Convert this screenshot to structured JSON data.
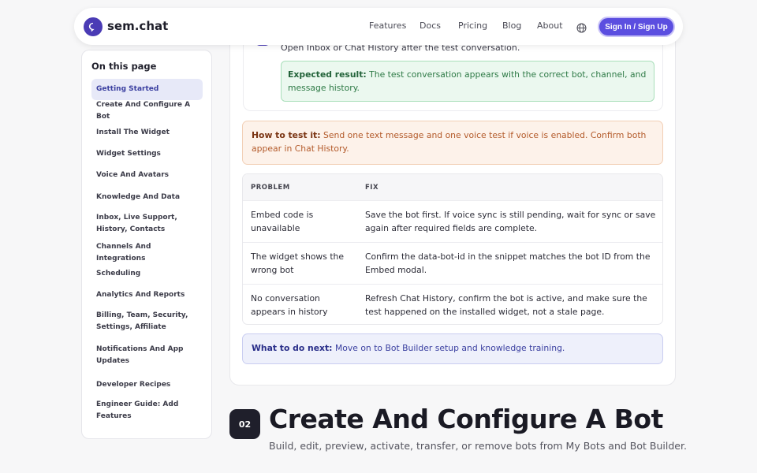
{
  "header": {
    "brand": "sem.chat",
    "nav": [
      "Features",
      "Docs",
      "Pricing",
      "Blog",
      "About"
    ],
    "signin_label": "Sign In / Sign Up"
  },
  "sidebar": {
    "title": "On this page",
    "items": [
      {
        "label": "Getting Started"
      },
      {
        "label": "Create And Configure A Bot"
      },
      {
        "label": "Install The Widget"
      },
      {
        "label": "Widget Settings"
      },
      {
        "label": "Voice And Avatars"
      },
      {
        "label": "Knowledge And Data"
      },
      {
        "label": "Inbox, Live Support, History, Contacts"
      },
      {
        "label": "Channels And Integrations"
      },
      {
        "label": "Scheduling"
      },
      {
        "label": "Analytics And Reports"
      },
      {
        "label": "Billing, Team, Security, Settings, Affiliate"
      },
      {
        "label": "Notifications And App Updates"
      },
      {
        "label": "Developer Recipes"
      },
      {
        "label": "Engineer Guide: Add Features"
      }
    ]
  },
  "content": {
    "step_text": "Open Inbox or Chat History after the test conversation.",
    "expected_label": "Expected result:",
    "expected_text": "The test conversation appears with the correct bot, channel, and message history.",
    "howto_label": "How to test it:",
    "howto_text": "Send one text message and one voice test if voice is enabled. Confirm both appear in Chat History.",
    "table": {
      "headers": [
        "PROBLEM",
        "FIX"
      ],
      "rows": [
        {
          "problem": "Embed code is unavailable",
          "fix": "Save the bot first. If voice sync is still pending, wait for sync or save again after required fields are complete."
        },
        {
          "problem": "The widget shows the wrong bot",
          "fix": "Confirm the data-bot-id in the snippet matches the bot ID from the Embed modal."
        },
        {
          "problem": "No conversation appears in history",
          "fix": "Refresh Chat History, confirm the bot is active, and make sure the test happened on the installed widget, not a stale page."
        }
      ]
    },
    "next_label": "What to do next:",
    "next_text": "Move on to Bot Builder setup and knowledge training."
  },
  "section": {
    "number": "02",
    "title": "Create And Configure A Bot",
    "subtitle": "Build, edit, preview, activate, transfer, or remove bots from My Bots and Bot Builder."
  }
}
